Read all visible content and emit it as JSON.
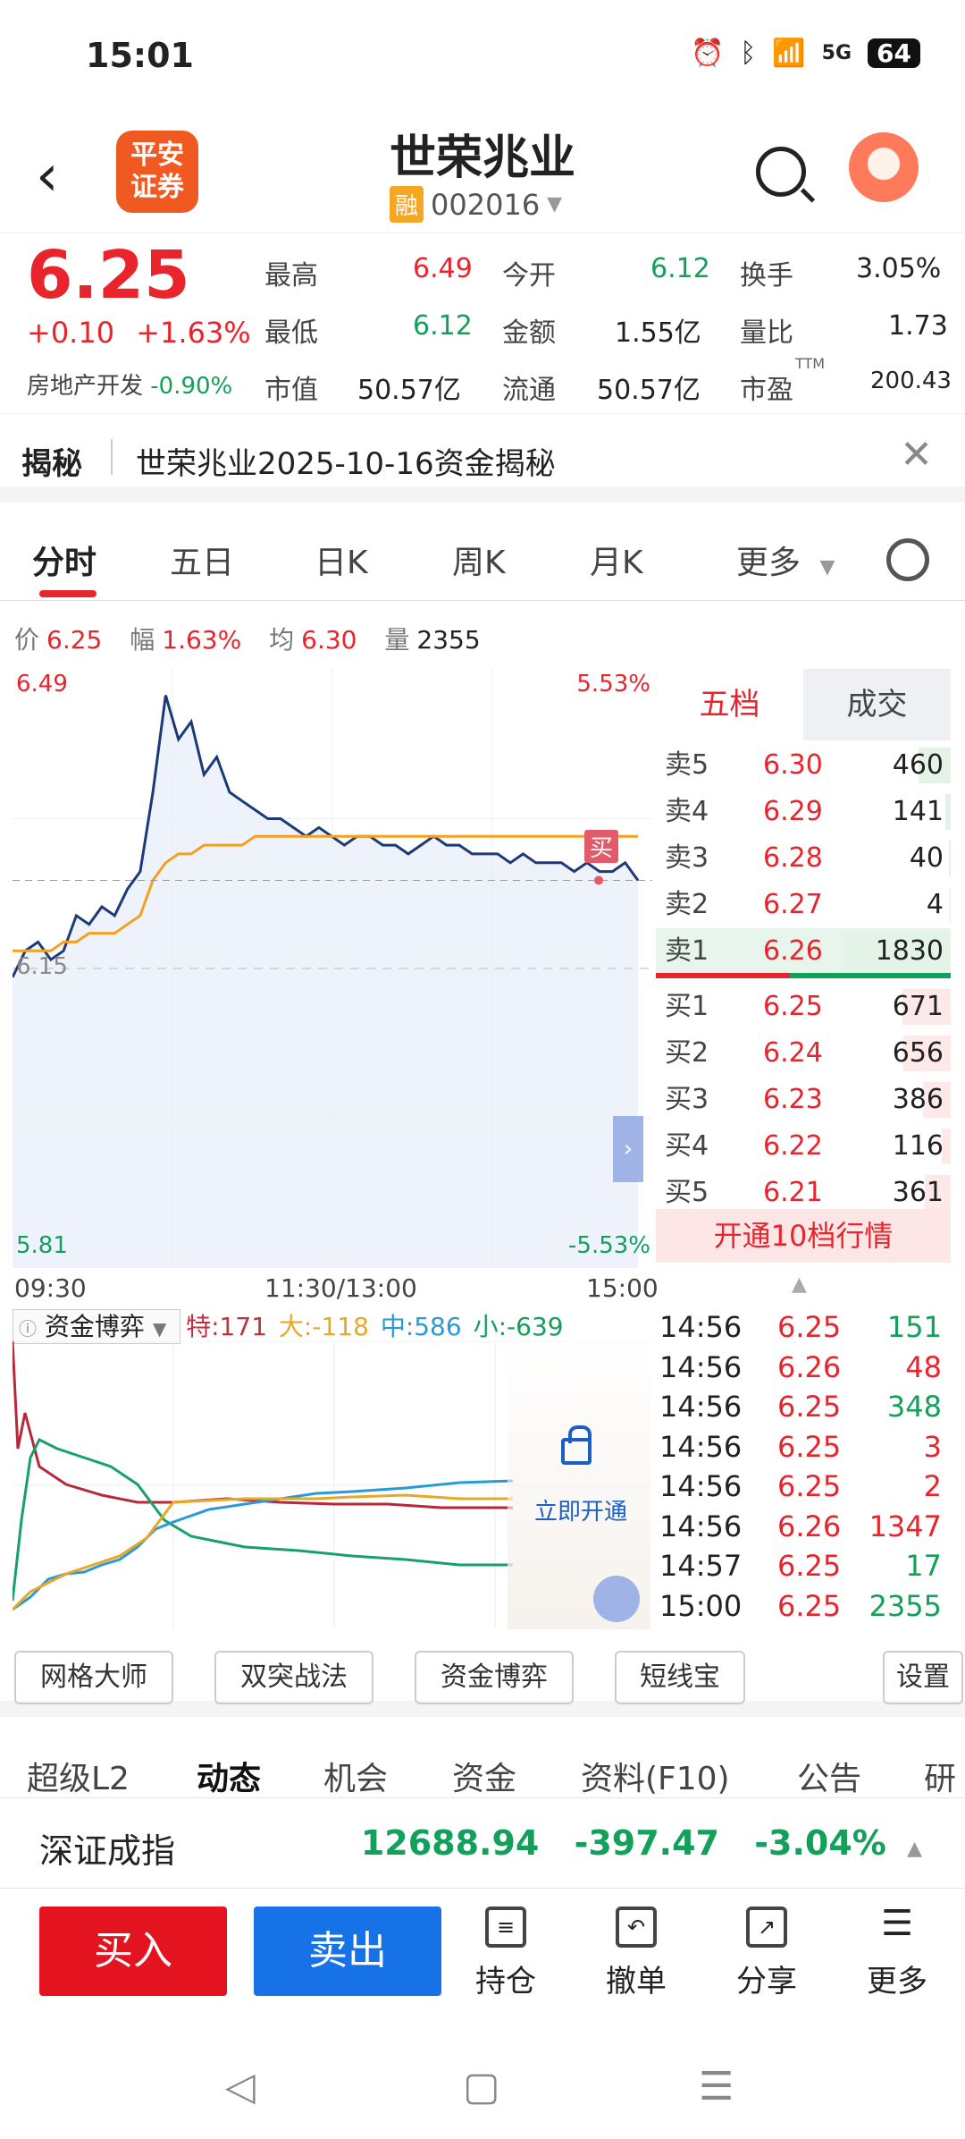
{
  "status": {
    "time": "15:01",
    "signal": "5G",
    "battery": "64"
  },
  "header": {
    "back_icon": "‹",
    "logo_text": "平安\n证券",
    "stock_name": "世荣兆业",
    "margin_badge": "融",
    "stock_code": "002016"
  },
  "quote": {
    "price": "6.25",
    "change": "+0.10",
    "change_pct": "+1.63%",
    "sector_name": "房地产开发",
    "sector_pct": "-0.90%",
    "fields": {
      "high_label": "最高",
      "high": "6.49",
      "low_label": "最低",
      "low": "6.12",
      "mcap_label": "市值",
      "mcap": "50.57亿",
      "open_label": "今开",
      "open": "6.12",
      "amount_label": "金额",
      "amount": "1.55亿",
      "float_label": "流通",
      "float": "50.57亿",
      "turnover_label": "换手",
      "turnover": "3.05%",
      "volratio_label": "量比",
      "volratio": "1.73",
      "pe_label": "市盈",
      "pe_sup": "TTM",
      "pe": "200.43"
    }
  },
  "reveal": {
    "tag": "揭秘",
    "text": "世荣兆业2025-10-16资金揭秘"
  },
  "tabs": [
    "分时",
    "五日",
    "日K",
    "周K",
    "月K",
    "更多"
  ],
  "infoline": {
    "price_label": "价",
    "price": "6.25",
    "range_label": "幅",
    "range": "1.63%",
    "avg_label": "均",
    "avg": "6.30",
    "vol_label": "量",
    "vol": "2355"
  },
  "chart_labels": {
    "top_left": "6.49",
    "top_right": "5.53%",
    "bottom_left": "5.81",
    "bottom_right": "-5.53%",
    "ref": "6.15",
    "buy_marker": "买",
    "t_start": "09:30",
    "t_mid": "11:30/13:00",
    "t_end": "15:00"
  },
  "chart_data": {
    "type": "line",
    "title": "",
    "ylim": [
      5.81,
      6.49
    ],
    "prev_close": 6.15,
    "series": [
      {
        "values": [
          6.14,
          6.17,
          6.18,
          6.16,
          6.17,
          6.21,
          6.2,
          6.22,
          6.21,
          6.24,
          6.26,
          6.35,
          6.46,
          6.41,
          6.43,
          6.37,
          6.39,
          6.35,
          6.34,
          6.33,
          6.32,
          6.32,
          6.31,
          6.3,
          6.31,
          6.3,
          6.29,
          6.3,
          6.3,
          6.29,
          6.29,
          6.28,
          6.29,
          6.3,
          6.29,
          6.29,
          6.28,
          6.28,
          6.28,
          6.27,
          6.28,
          6.27,
          6.27,
          6.27,
          6.26,
          6.27,
          6.26,
          6.26,
          6.27,
          6.25
        ]
      },
      {
        "values": [
          6.17,
          6.17,
          6.17,
          6.17,
          6.18,
          6.18,
          6.19,
          6.19,
          6.19,
          6.2,
          6.21,
          6.25,
          6.27,
          6.28,
          6.28,
          6.29,
          6.29,
          6.29,
          6.29,
          6.3,
          6.3,
          6.3,
          6.3,
          6.3,
          6.3,
          6.3,
          6.3,
          6.3,
          6.3,
          6.3,
          6.3,
          6.3,
          6.3,
          6.3,
          6.3,
          6.3,
          6.3,
          6.3,
          6.3,
          6.3,
          6.3,
          6.3,
          6.3,
          6.3,
          6.3,
          6.3,
          6.3,
          6.3,
          6.3,
          6.3
        ]
      }
    ]
  },
  "book": {
    "tabs": [
      "五档",
      "成交"
    ],
    "sells": [
      {
        "label": "卖5",
        "price": "6.30",
        "vol": "460",
        "w": 0.3
      },
      {
        "label": "卖4",
        "price": "6.29",
        "vol": "141",
        "w": 0.05
      },
      {
        "label": "卖3",
        "price": "6.28",
        "vol": "40",
        "w": 0.02
      },
      {
        "label": "卖2",
        "price": "6.27",
        "vol": "4",
        "w": 0.01
      },
      {
        "label": "卖1",
        "price": "6.26",
        "vol": "1830",
        "w": 1.0
      }
    ],
    "buys": [
      {
        "label": "买1",
        "price": "6.25",
        "vol": "671",
        "w": 0.45
      },
      {
        "label": "买2",
        "price": "6.24",
        "vol": "656",
        "w": 0.44
      },
      {
        "label": "买3",
        "price": "6.23",
        "vol": "386",
        "w": 0.26
      },
      {
        "label": "买4",
        "price": "6.22",
        "vol": "116",
        "w": 0.08
      },
      {
        "label": "买5",
        "price": "6.21",
        "vol": "361",
        "w": 0.24
      }
    ],
    "open10": "开通10档行情"
  },
  "flow": {
    "title": "资金博弈",
    "te": "特:171",
    "da": "大:-118",
    "zhong": "中:586",
    "xiao": "小:-639",
    "unlock": "立即开通"
  },
  "trades": [
    {
      "time": "14:56",
      "price": "6.25",
      "vol": "151",
      "dir": "green"
    },
    {
      "time": "14:56",
      "price": "6.26",
      "vol": "48",
      "dir": "red"
    },
    {
      "time": "14:56",
      "price": "6.25",
      "vol": "348",
      "dir": "green"
    },
    {
      "time": "14:56",
      "price": "6.25",
      "vol": "3",
      "dir": "red"
    },
    {
      "time": "14:56",
      "price": "6.25",
      "vol": "2",
      "dir": "red"
    },
    {
      "time": "14:56",
      "price": "6.26",
      "vol": "1347",
      "dir": "red"
    },
    {
      "time": "14:57",
      "price": "6.25",
      "vol": "17",
      "dir": "green"
    },
    {
      "time": "15:00",
      "price": "6.25",
      "vol": "2355",
      "dir": "green"
    }
  ],
  "tools": [
    "网格大师",
    "双突战法",
    "资金博弈",
    "短线宝",
    "设置"
  ],
  "lowtabs": [
    "超级L2",
    "动态",
    "机会",
    "资金",
    "资料(F10)",
    "公告",
    "研"
  ],
  "index": {
    "name": "深证成指",
    "value": "12688.94",
    "change": "-397.47",
    "pct": "-3.04%"
  },
  "actions": {
    "buy": "买入",
    "sell": "卖出",
    "hold": "持仓",
    "cancel": "撤单",
    "share": "分享",
    "more": "更多"
  }
}
